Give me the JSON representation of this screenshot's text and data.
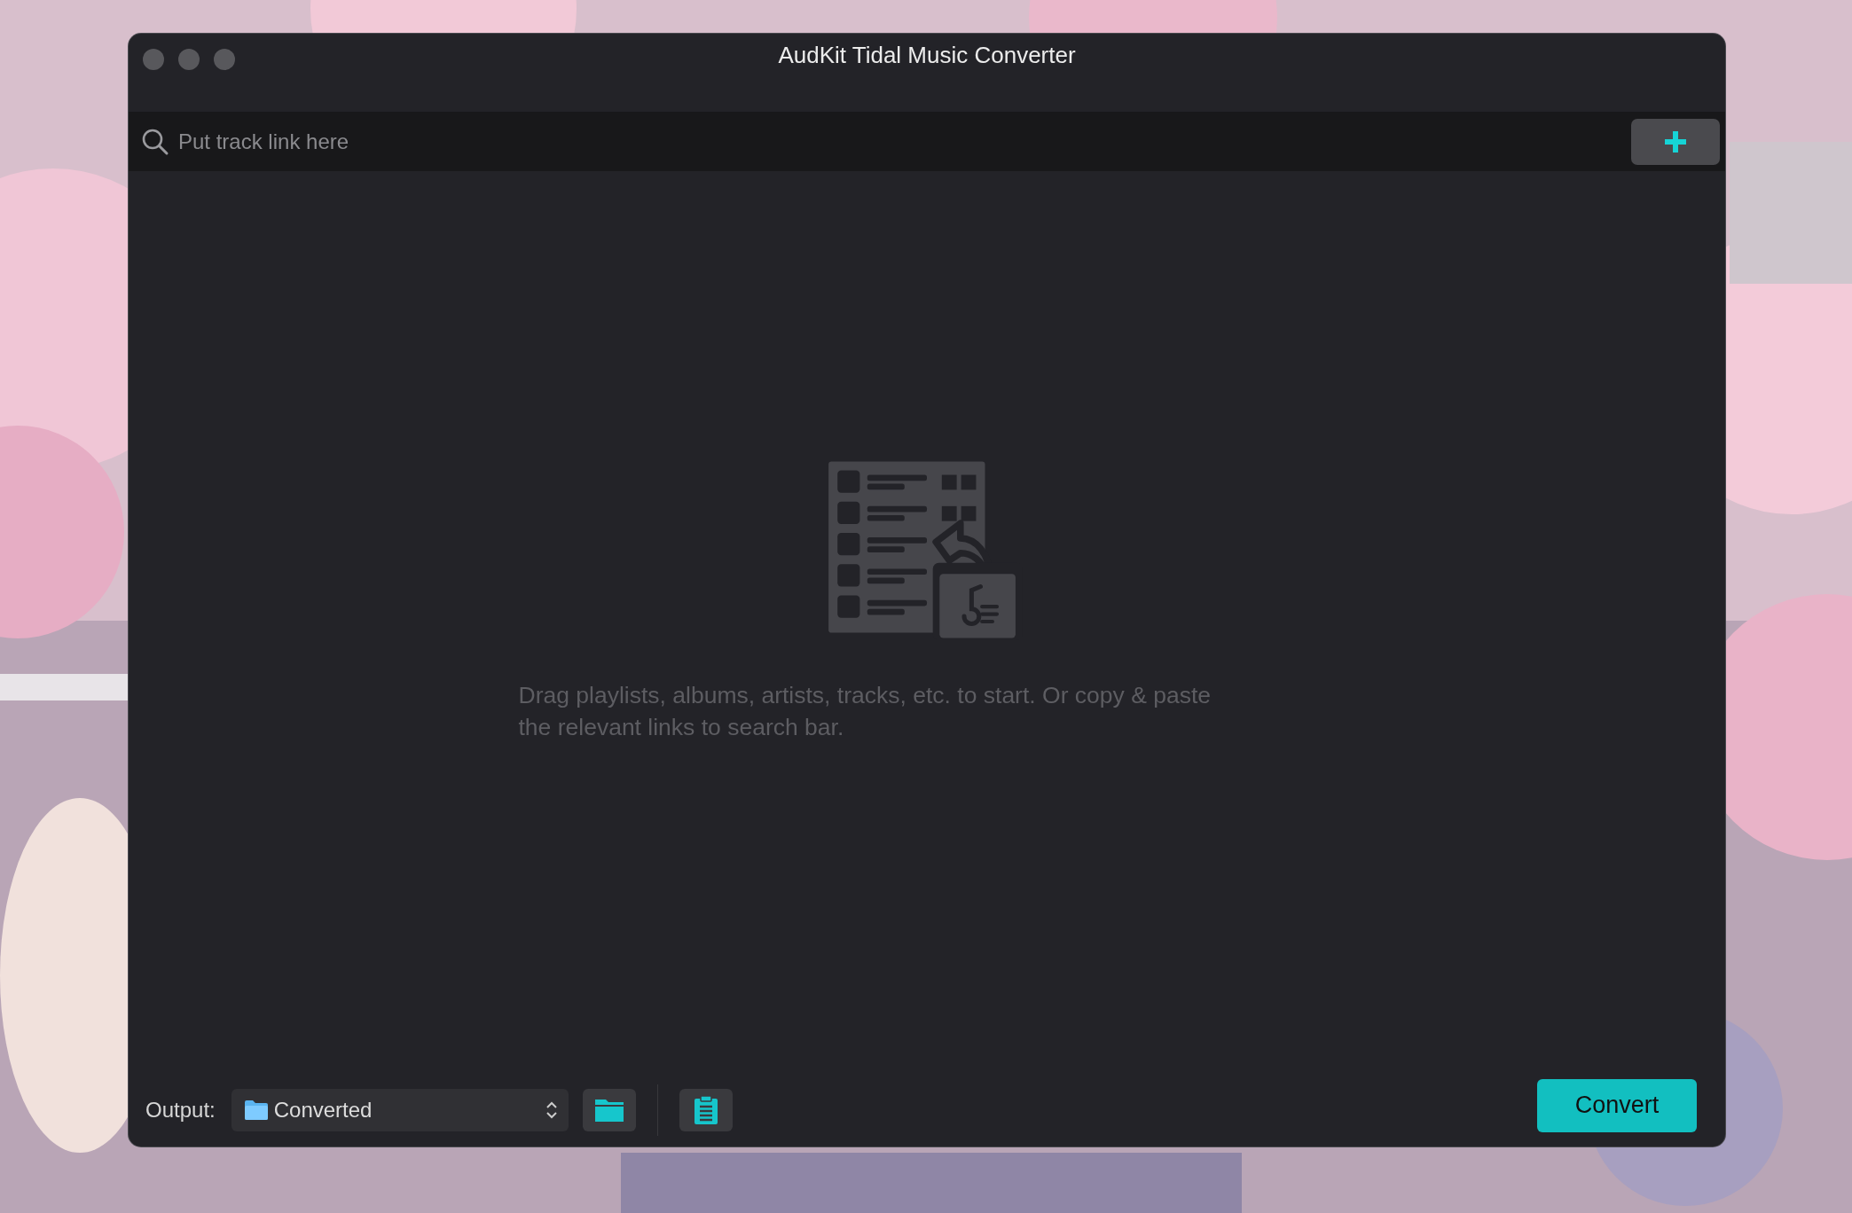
{
  "window": {
    "title": "AudKit Tidal Music Converter"
  },
  "search": {
    "placeholder": "Put track link here"
  },
  "empty_state": {
    "message": "Drag playlists, albums, artists, tracks, etc. to start. Or copy & paste the relevant links to search bar."
  },
  "output": {
    "label": "Output:",
    "folder": "Converted"
  },
  "convert_button": {
    "label": "Convert"
  }
}
